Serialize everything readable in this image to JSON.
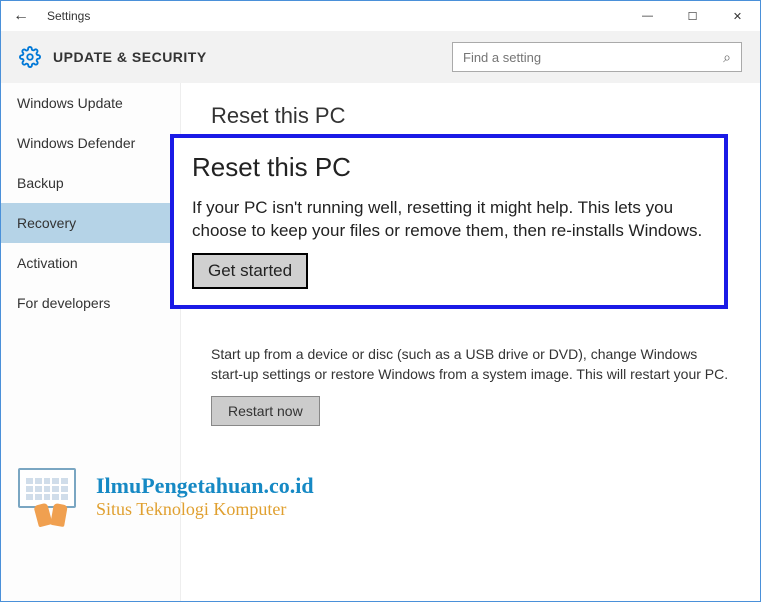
{
  "titlebar": {
    "title": "Settings"
  },
  "header": {
    "title": "UPDATE & SECURITY"
  },
  "search": {
    "placeholder": "Find a setting"
  },
  "sidebar": {
    "items": [
      {
        "label": "Windows Update"
      },
      {
        "label": "Windows Defender"
      },
      {
        "label": "Backup"
      },
      {
        "label": "Recovery"
      },
      {
        "label": "Activation"
      },
      {
        "label": "For developers"
      }
    ]
  },
  "main": {
    "reset": {
      "title": "Reset this PC"
    },
    "advanced": {
      "text": "Start up from a device or disc (such as a USB drive or DVD), change Windows start-up settings or restore Windows from a system image. This will restart your PC.",
      "button": "Restart now"
    }
  },
  "highlight": {
    "title": "Reset this PC",
    "text": "If your PC isn't running well, resetting it might help. This lets you choose to keep your files or remove them, then re-installs Windows.",
    "button": "Get started"
  },
  "watermark": {
    "line1": "IlmuPengetahuan.co.id",
    "line2": "Situs Teknologi Komputer"
  }
}
